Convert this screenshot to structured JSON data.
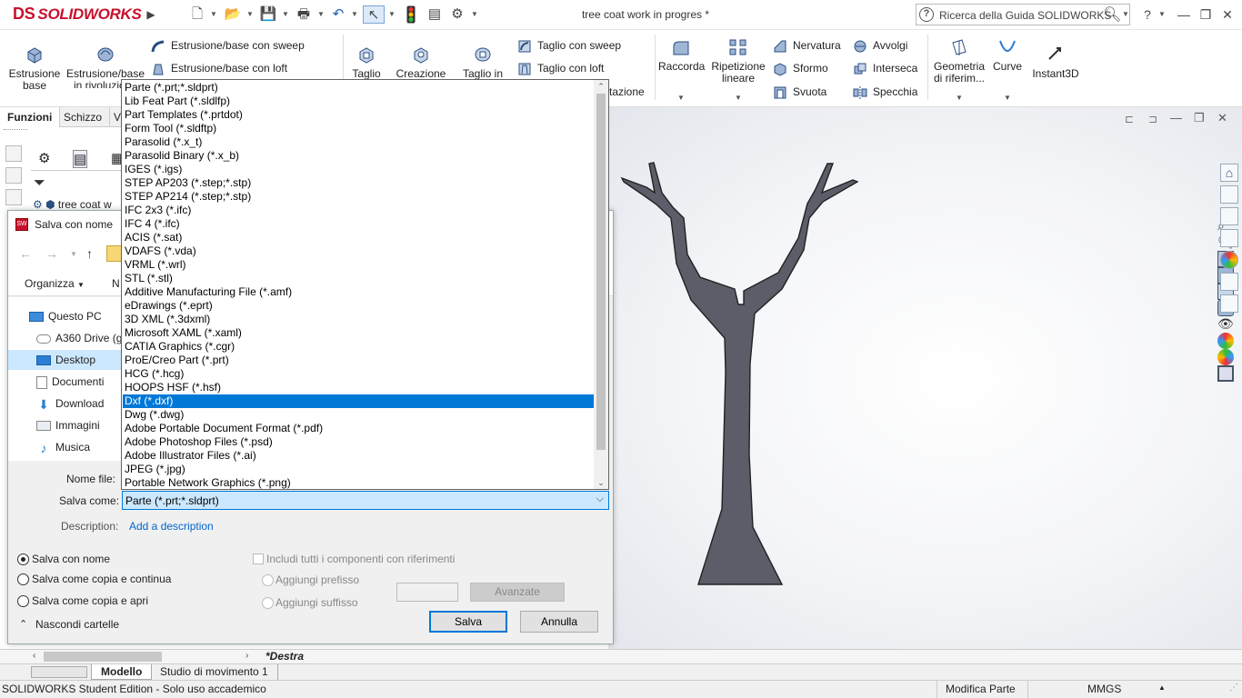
{
  "app": {
    "logo_text": "SOLIDWORKS",
    "logo_prefix": "DS",
    "document_title": "tree coat work in progres *",
    "help_search_placeholder": "Ricerca della Guida SOLIDWORKS",
    "brand_color": "#c8102e"
  },
  "ribbon": {
    "extrude_base": "Estrusione base",
    "revolve_base": "Estrusione/base in rivoluzione",
    "sweep_base": "Estrusione/base con sweep",
    "loft_base": "Estrusione/base con loft",
    "cut": "Taglio",
    "hole_wizard": "Creazione guidata fori",
    "revolve_cut": "Taglio in rivoluzione",
    "sweep_cut": "Taglio con sweep",
    "loft_cut": "Taglio con loft",
    "boundary_cut_partial": "tazione",
    "fillet": "Raccorda",
    "linear_pattern": "Ripetizione lineare",
    "rib": "Nervatura",
    "wrap": "Avvolgi",
    "draft": "Sformo",
    "intersect": "Interseca",
    "shell": "Svuota",
    "mirror": "Specchia",
    "ref_geometry": "Geometria di riferim...",
    "curves": "Curve",
    "instant3d": "Instant3D"
  },
  "feature_tabs": [
    "Funzioni",
    "Schizzo",
    "V"
  ],
  "feature_tree": {
    "root_label": "tree coat w"
  },
  "dialog": {
    "title": "Salva con nome",
    "organize": "Organizza",
    "new_folder_partial": "N",
    "tree": [
      {
        "label": "Questo PC",
        "icon": "pc-icon"
      },
      {
        "label": "A360 Drive (gi",
        "icon": "cloud-icon"
      },
      {
        "label": "Desktop",
        "icon": "desktop-icon",
        "selected": true
      },
      {
        "label": "Documenti",
        "icon": "documents-icon"
      },
      {
        "label": "Download",
        "icon": "download-icon"
      },
      {
        "label": "Immagini",
        "icon": "images-icon"
      },
      {
        "label": "Musica",
        "icon": "music-icon"
      }
    ],
    "filename_label": "Nome file:",
    "saveas_label": "Salva come:",
    "saveas_value": "Parte (*.prt;*.sldprt)",
    "description_label": "Description:",
    "description_link": "Add a description",
    "radio_save_as": "Salva con nome",
    "radio_save_copy_continue": "Salva come copia e continua",
    "radio_save_copy_open": "Salva come copia e apri",
    "include_refs": "Includi tutti i componenti con riferimenti",
    "add_prefix": "Aggiungi prefisso",
    "add_suffix": "Aggiungi suffisso",
    "advanced": "Avanzate",
    "save": "Salva",
    "cancel": "Annulla",
    "hide_folders": "Nascondi cartelle"
  },
  "file_types": [
    "Parte (*.prt;*.sldprt)",
    "Lib Feat Part (*.sldlfp)",
    "Part Templates (*.prtdot)",
    "Form Tool (*.sldftp)",
    "Parasolid (*.x_t)",
    "Parasolid Binary (*.x_b)",
    "IGES (*.igs)",
    "STEP AP203 (*.step;*.stp)",
    "STEP AP214 (*.step;*.stp)",
    "IFC 2x3 (*.ifc)",
    "IFC 4 (*.ifc)",
    "ACIS (*.sat)",
    "VDAFS (*.vda)",
    "VRML (*.wrl)",
    "STL (*.stl)",
    "Additive Manufacturing File (*.amf)",
    "eDrawings (*.eprt)",
    "3D XML (*.3dxml)",
    "Microsoft XAML (*.xaml)",
    "CATIA Graphics (*.cgr)",
    "ProE/Creo Part (*.prt)",
    "HCG (*.hcg)",
    "HOOPS HSF (*.hsf)",
    "Dxf (*.dxf)",
    "Dwg (*.dwg)",
    "Adobe Portable Document Format (*.pdf)",
    "Adobe Photoshop Files (*.psd)",
    "Adobe Illustrator Files (*.ai)",
    "JPEG (*.jpg)",
    "Portable Network Graphics (*.png)"
  ],
  "file_types_selected_index": 23,
  "viewport": {
    "view_label": "*Destra",
    "model_color": "#5b5d69"
  },
  "bottom_tabs": [
    "Modello",
    "Studio di movimento 1"
  ],
  "status": {
    "edition": "SOLIDWORKS Student Edition - Solo uso accademico",
    "mode": "Modifica Parte",
    "units": "MMGS"
  }
}
